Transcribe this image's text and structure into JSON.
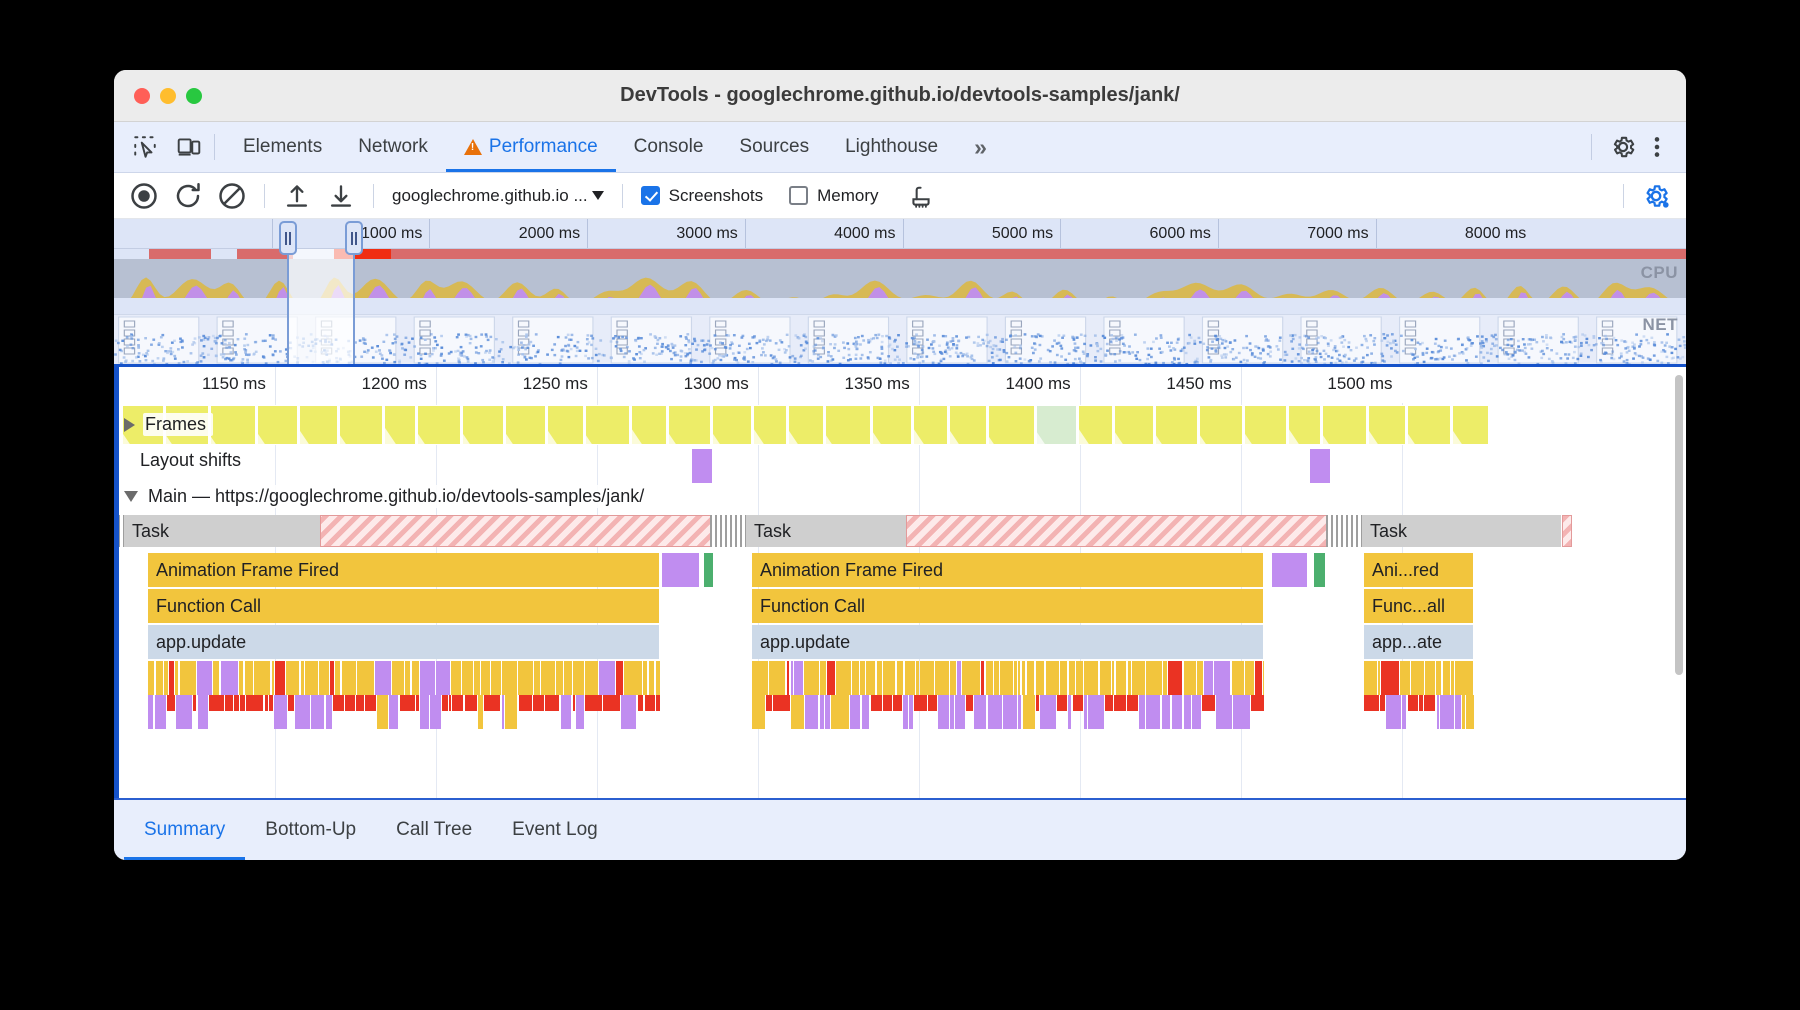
{
  "window": {
    "title": "DevTools - googlechrome.github.io/devtools-samples/jank/",
    "traffic_lights": [
      "close",
      "minimize",
      "maximize"
    ]
  },
  "panel_tabs": {
    "icons": [
      "inspect-element-icon",
      "device-toolbar-icon"
    ],
    "items": [
      {
        "label": "Elements",
        "active": false,
        "warning": false
      },
      {
        "label": "Network",
        "active": false,
        "warning": false
      },
      {
        "label": "Performance",
        "active": true,
        "warning": true
      },
      {
        "label": "Console",
        "active": false,
        "warning": false
      },
      {
        "label": "Sources",
        "active": false,
        "warning": false
      },
      {
        "label": "Lighthouse",
        "active": false,
        "warning": false
      }
    ],
    "more_label": "»",
    "settings_label": "gear-icon",
    "menu_label": "kebab-menu-icon"
  },
  "toolbar": {
    "record_label": "record-button",
    "reload_label": "reload-and-record-button",
    "clear_label": "clear-button",
    "upload_label": "load-profile-button",
    "download_label": "save-profile-button",
    "origin_value": "googlechrome.github.io ...",
    "screenshots_label": "Screenshots",
    "screenshots_checked": true,
    "memory_label": "Memory",
    "memory_checked": false,
    "gc_label": "collect-garbage-button",
    "capture_settings_label": "capture-settings-gear-icon"
  },
  "overview": {
    "ticks": [
      "1000 ms",
      "2000 ms",
      "3000 ms",
      "4000 ms",
      "5000 ms",
      "6000 ms",
      "7000 ms",
      "8000 ms"
    ],
    "cpu_label": "CPU",
    "net_label": "NET",
    "selection_start_pct": 12.6,
    "selection_end_pct": 17.6,
    "colors": {
      "cpu_scripting": "#f2c53d",
      "cpu_rendering": "#c08df0",
      "cpu_painting": "#4caf6e",
      "cpu_idle": "#b7c0d2",
      "long_task_red": "#d96b6b",
      "long_task_hot": "#f02d12",
      "accent": "#1a73e8"
    }
  },
  "flame": {
    "ticks": [
      "1150 ms",
      "1200 ms",
      "1250 ms",
      "1300 ms",
      "1350 ms",
      "1400 ms",
      "1450 ms",
      "1500 ms"
    ],
    "tracks": [
      {
        "name": "Frames",
        "label": "Frames",
        "collapsed": true
      },
      {
        "name": "Layout shifts",
        "label": "Layout shifts",
        "collapsed": false
      },
      {
        "name": "Main",
        "label": "Main — https://googlechrome.github.io/devtools-samples/jank/",
        "collapsed": false
      }
    ],
    "groups": [
      {
        "task_label": "Task",
        "rows": [
          {
            "label": "Animation Frame Fired",
            "type": "yellow"
          },
          {
            "label": "Function Call",
            "type": "yellow"
          },
          {
            "label": "app.update",
            "type": "blue"
          }
        ]
      },
      {
        "task_label": "Task",
        "rows": [
          {
            "label": "Animation Frame Fired",
            "type": "yellow"
          },
          {
            "label": "Function Call",
            "type": "yellow"
          },
          {
            "label": "app.update",
            "type": "blue"
          }
        ]
      },
      {
        "task_label": "Task",
        "rows": [
          {
            "label": "Ani...red",
            "type": "yellow"
          },
          {
            "label": "Func...all",
            "type": "yellow"
          },
          {
            "label": "app...ate",
            "type": "blue"
          }
        ]
      }
    ]
  },
  "bottom_tabs": {
    "items": [
      {
        "label": "Summary",
        "active": true
      },
      {
        "label": "Bottom-Up",
        "active": false
      },
      {
        "label": "Call Tree",
        "active": false
      },
      {
        "label": "Event Log",
        "active": false
      }
    ]
  }
}
